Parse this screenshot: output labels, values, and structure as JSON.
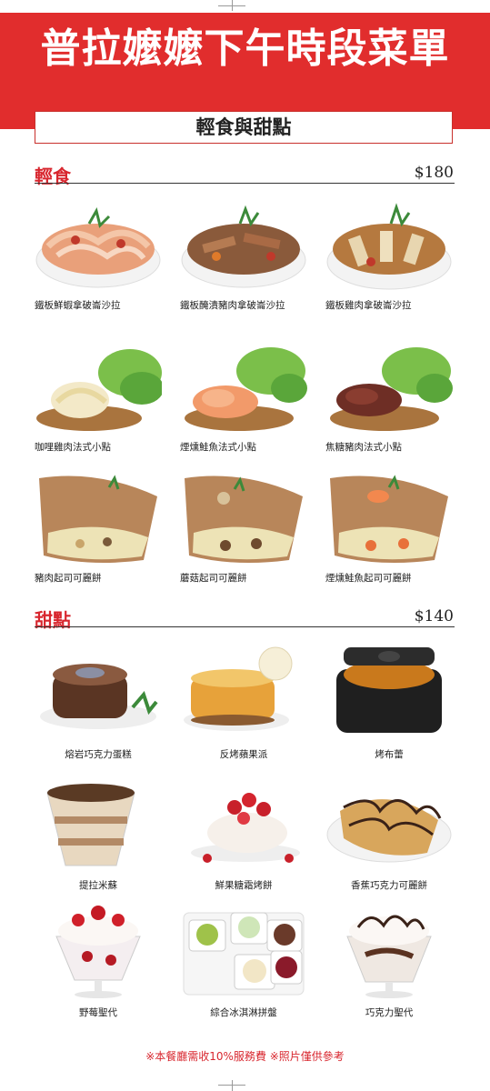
{
  "menu": {
    "title": "普拉嬤嬤下午時段菜單",
    "subtitle": "輕食與甜點"
  },
  "sections": [
    {
      "title": "輕食",
      "price": "$180",
      "items": [
        {
          "name": "鐵板鮮蝦拿破崙沙拉",
          "icon": "shrimp-salad-photo"
        },
        {
          "name": "鐵板醃漬豬肉拿破崙沙拉",
          "icon": "pork-salad-photo"
        },
        {
          "name": "鐵板雞肉拿破崙沙拉",
          "icon": "chicken-salad-photo"
        },
        {
          "name": "咖哩雞肉法式小點",
          "icon": "curry-chicken-tartine-photo"
        },
        {
          "name": "煙燻鮭魚法式小點",
          "icon": "salmon-tartine-photo"
        },
        {
          "name": "焦糖豬肉法式小點",
          "icon": "caramel-pork-tartine-photo"
        },
        {
          "name": "豬肉起司可麗餅",
          "icon": "pork-crepe-photo"
        },
        {
          "name": "蘑菇起司可麗餅",
          "icon": "mushroom-crepe-photo"
        },
        {
          "name": "煙燻鮭魚起司可麗餅",
          "icon": "salmon-crepe-photo"
        }
      ]
    },
    {
      "title": "甜點",
      "price": "$140",
      "items": [
        {
          "name": "熔岩巧克力蛋糕",
          "icon": "lava-cake-photo"
        },
        {
          "name": "反烤蘋果派",
          "icon": "tarte-tatin-photo"
        },
        {
          "name": "烤布蕾",
          "icon": "creme-brulee-photo"
        },
        {
          "name": "提拉米蘇",
          "icon": "tiramisu-photo"
        },
        {
          "name": "鮮果糖霜烤餅",
          "icon": "meringue-photo"
        },
        {
          "name": "香蕉巧克力可麗餅",
          "icon": "banana-crepe-photo"
        },
        {
          "name": "野莓聖代",
          "icon": "berry-sundae-photo"
        },
        {
          "name": "綜合冰淇淋拼盤",
          "icon": "ice-cream-platter-photo"
        },
        {
          "name": "巧克力聖代",
          "icon": "chocolate-sundae-photo"
        }
      ]
    }
  ],
  "footer": "※本餐廳需收10%服務費 ※照片僅供參考",
  "colors": {
    "brand_red": "#e12d2d",
    "accent_red": "#d8262e"
  }
}
